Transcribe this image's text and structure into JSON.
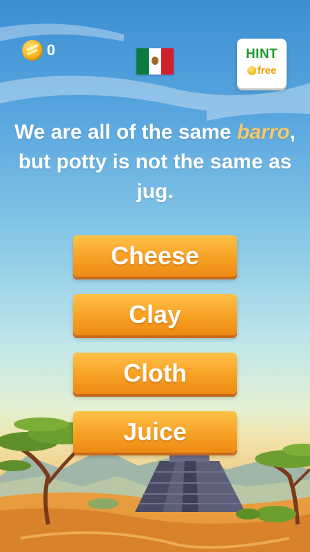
{
  "header": {
    "coin_count": "0",
    "hint": {
      "title": "HINT",
      "subtitle": "free"
    }
  },
  "question": {
    "before": "We are all of the same ",
    "highlight": "barro",
    "after": ", but potty is not the same as jug."
  },
  "answers": [
    "Cheese",
    "Clay",
    "Cloth",
    "Juice"
  ],
  "colors": {
    "answer_button": "#f7a123",
    "highlight_word": "#f6c86a",
    "hint_title": "#1e9a2b",
    "hint_free": "#f29d00"
  },
  "icons": {
    "coins": "coin-icon",
    "flag": "mexico-flag-icon"
  }
}
